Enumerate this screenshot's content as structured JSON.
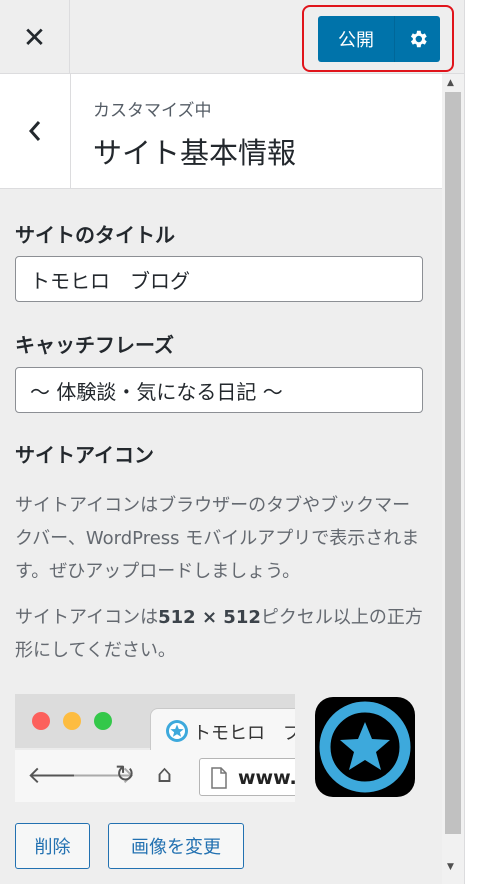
{
  "header": {
    "close_glyph": "✕",
    "publish_label": "公開"
  },
  "section": {
    "back_glyph": "‹",
    "customizing": "カスタマイズ中",
    "title": "サイト基本情報"
  },
  "site_title": {
    "label": "サイトのタイトル",
    "value": "トモヒロ　ブログ"
  },
  "tagline": {
    "label": "キャッチフレーズ",
    "value": "〜 体験談・気になる日記 〜"
  },
  "site_icon": {
    "label": "サイトアイコン",
    "description": "サイトアイコンはブラウザーのタブやブックマークバー、WordPress モバイルアプリで表示されます。ぜひアップロードしましょう。",
    "size_note_prefix": "サイトアイコンは",
    "size_note_bold": "512 × 512",
    "size_note_suffix": "ピクセル以上の正方形にしてください。",
    "preview_tab_text": "トモヒロ　ブ",
    "preview_url_text": "www.",
    "remove_label": "削除",
    "change_label": "画像を変更"
  },
  "colors": {
    "accent": "#0073aa",
    "highlight_border": "#e0141b",
    "icon_blue": "#3da9dc"
  }
}
